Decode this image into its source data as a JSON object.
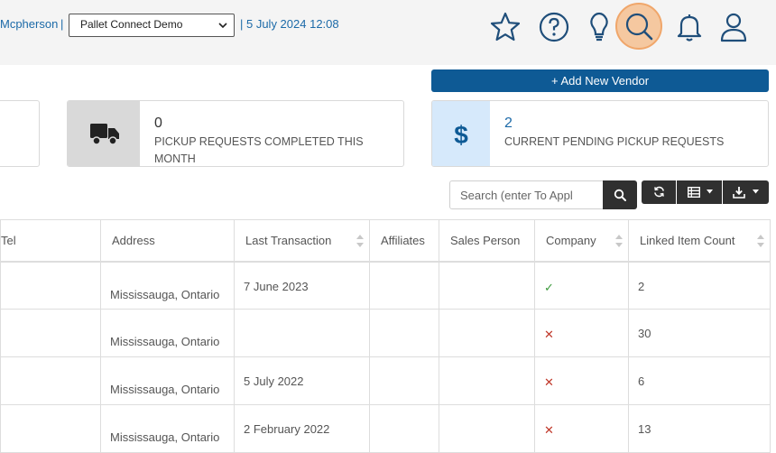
{
  "header": {
    "user_name": "Mcpherson",
    "separator": "|",
    "organization": "Pallet Connect Demo",
    "datetime": "| 5 July 2024 12:08",
    "icons": [
      "star-icon",
      "help-icon",
      "lightbulb-icon",
      "search-icon",
      "bell-icon",
      "user-icon"
    ]
  },
  "actions": {
    "add_vendor": "+ Add New Vendor"
  },
  "cards": [
    {
      "value": "0",
      "label": "PICKUP REQUESTS COMPLETED THIS MONTH",
      "icon": "truck-icon"
    },
    {
      "value": "2",
      "label": "CURRENT PENDING PICKUP REQUESTS",
      "icon": "dollar-icon"
    }
  ],
  "search": {
    "placeholder": "Search (enter To Appl"
  },
  "table": {
    "columns": [
      "Tel",
      "Address",
      "Last Transaction",
      "Affiliates",
      "Sales Person",
      "Company",
      "Linked Item Count"
    ],
    "rows": [
      {
        "tel": "",
        "address": "Mississauga, Ontario",
        "last_transaction": "7 June 2023",
        "affiliates": "",
        "sales_person": "",
        "company": "✓",
        "linked_item_count": "2"
      },
      {
        "tel": "",
        "address": "Mississauga, Ontario",
        "last_transaction": "",
        "affiliates": "",
        "sales_person": "",
        "company": "✕",
        "linked_item_count": "30"
      },
      {
        "tel": "",
        "address": "Mississauga, Ontario",
        "last_transaction": "5 July 2022",
        "affiliates": "",
        "sales_person": "",
        "company": "✕",
        "linked_item_count": "6"
      },
      {
        "tel": "",
        "address": "Mississauga, Ontario",
        "last_transaction": "2 February 2022",
        "affiliates": "",
        "sales_person": "",
        "company": "✕",
        "linked_item_count": "13"
      }
    ]
  },
  "colors": {
    "primary": "#0e5a95",
    "link": "#1c6aa8",
    "check": "#3c9a3c",
    "cross": "#c0392b",
    "highlight": "#f5c8a0"
  }
}
